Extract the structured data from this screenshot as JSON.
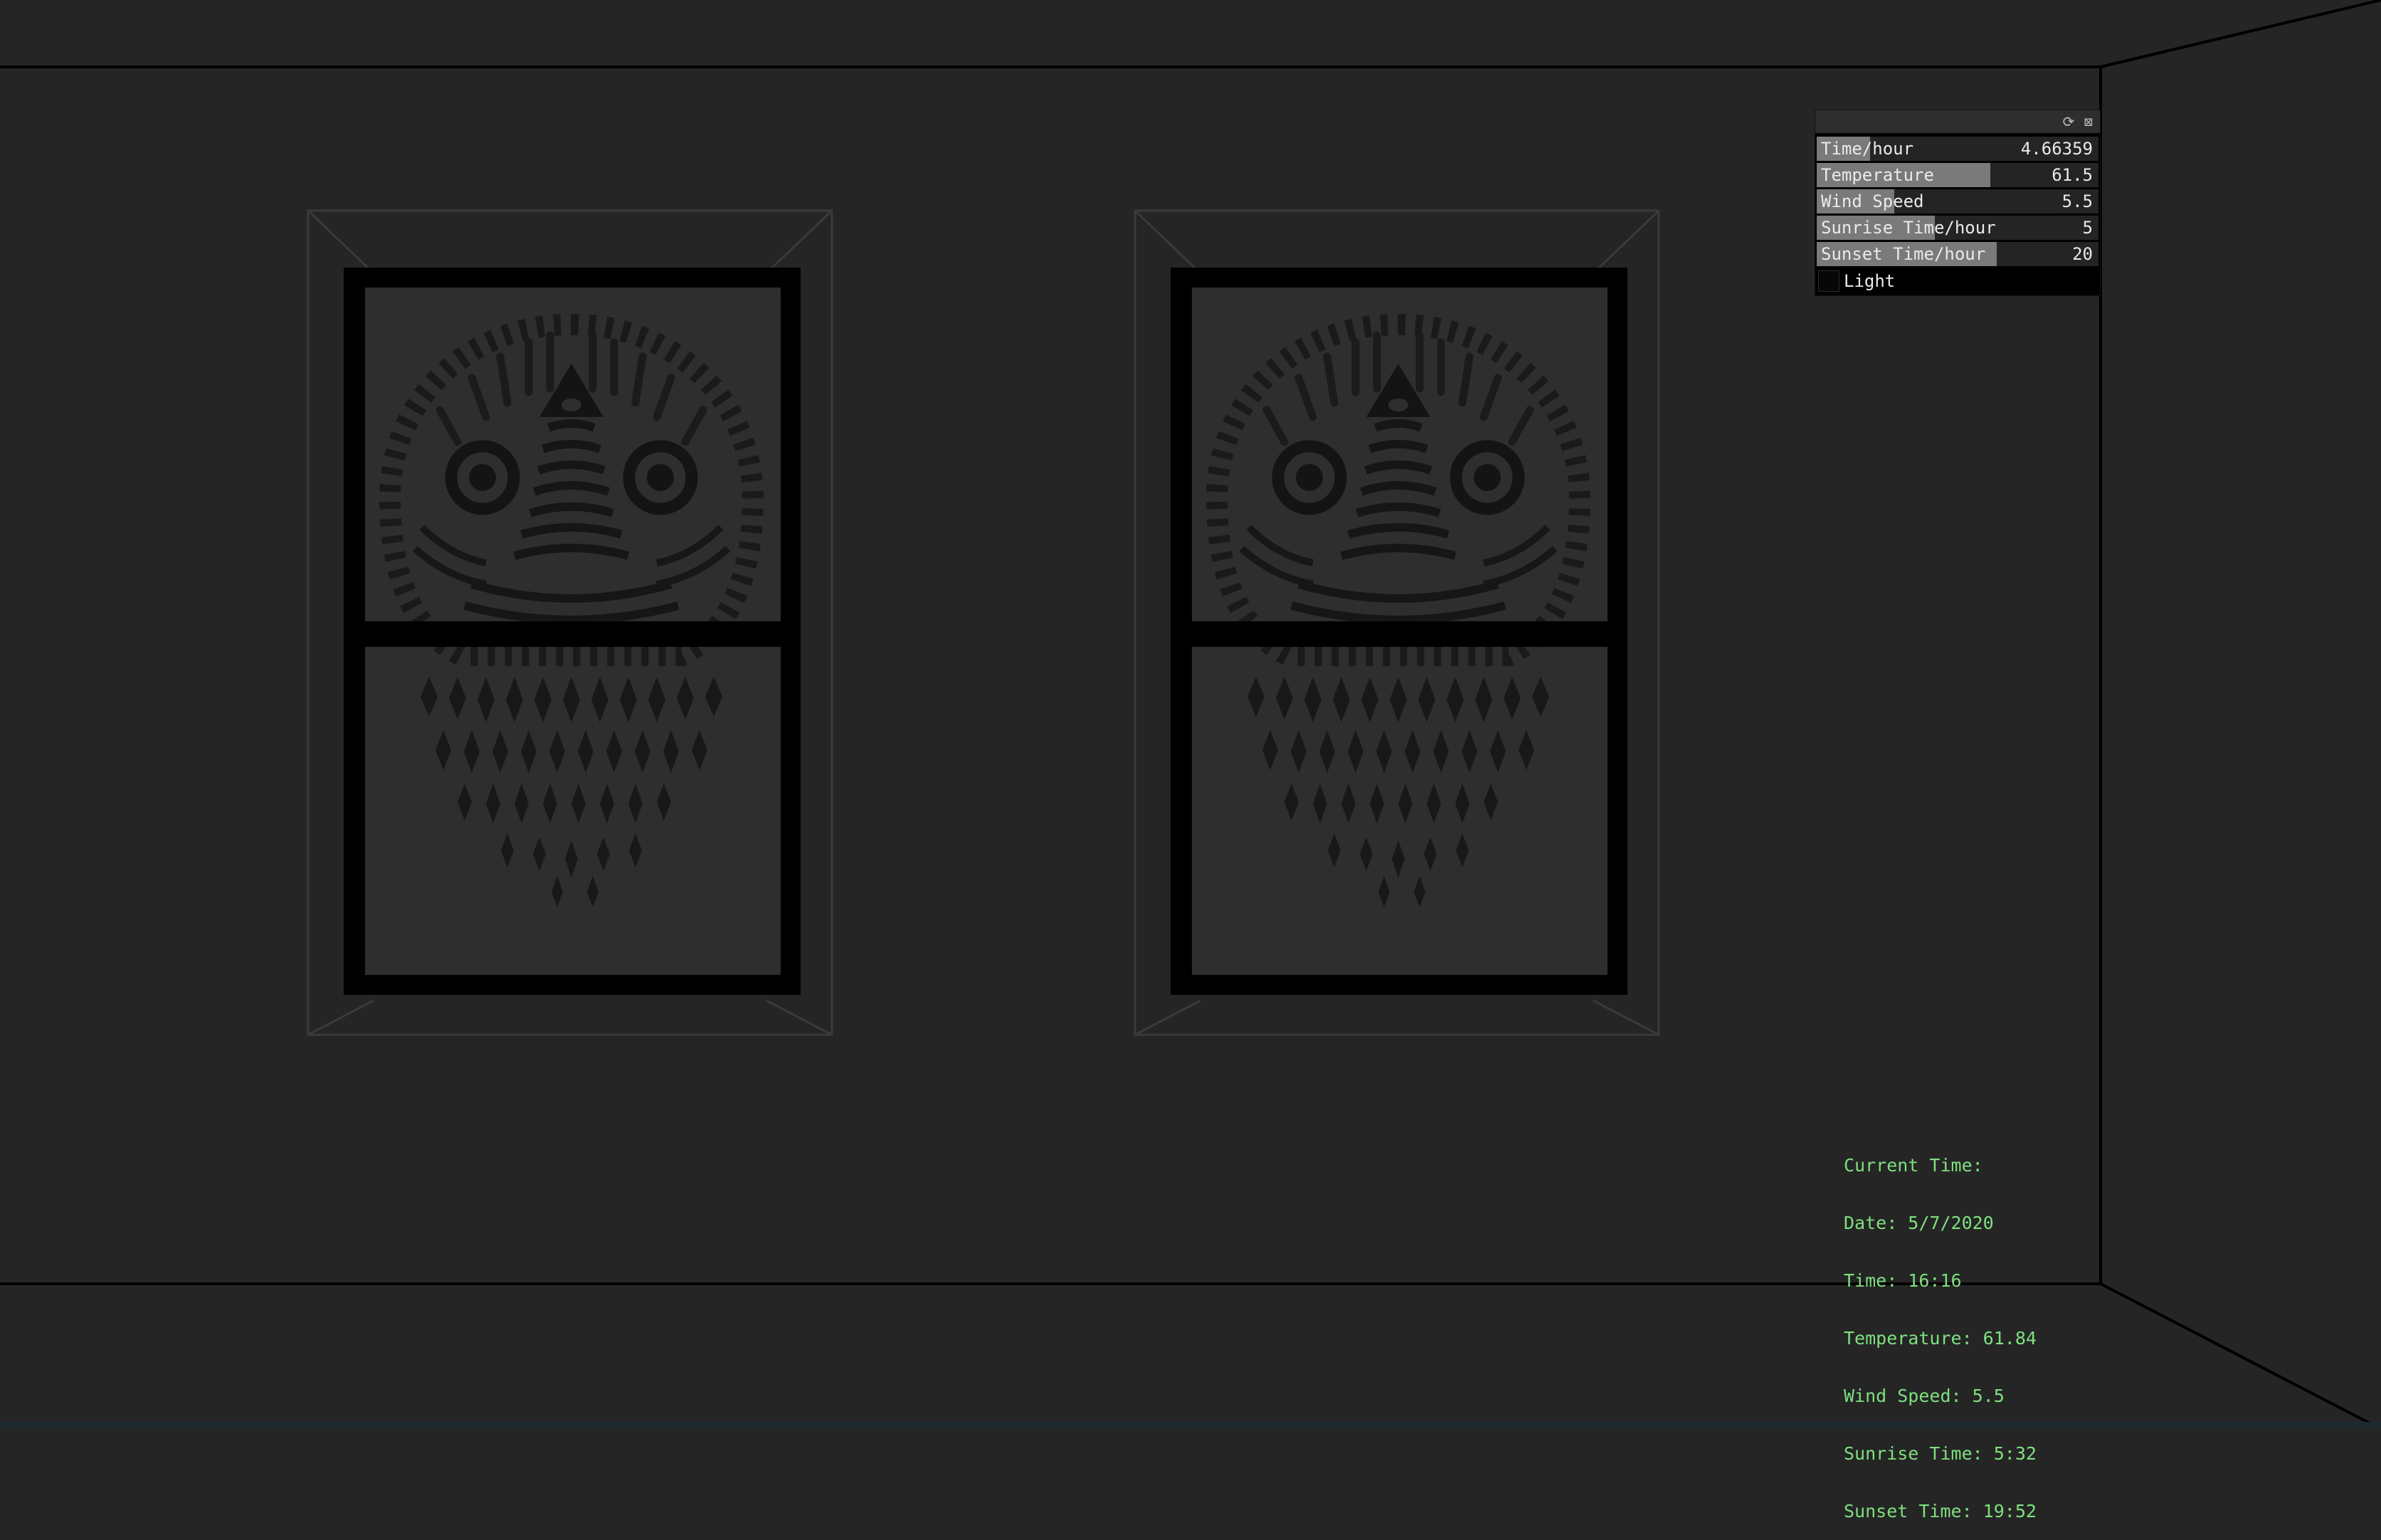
{
  "colors": {
    "background": "#252525",
    "info_text": "#7ee07e",
    "slider_fill": "#7a7a7a",
    "frame": "#000000",
    "glass": "#2e2e2e"
  },
  "gui": {
    "header_icons": [
      "refresh-icon",
      "save-icon"
    ],
    "sliders": [
      {
        "label": "Time/hour",
        "value": "4.66359",
        "fill_fraction": 0.19
      },
      {
        "label": "Temperature",
        "value": "61.5",
        "fill_fraction": 0.615
      },
      {
        "label": "Wind Speed",
        "value": "5.5",
        "fill_fraction": 0.275
      },
      {
        "label": "Sunrise Time/hour",
        "value": "5",
        "fill_fraction": 0.42
      },
      {
        "label": "Sunset Time/hour",
        "value": "20",
        "fill_fraction": 0.64
      }
    ],
    "toggle": {
      "label": "Light",
      "checked": false
    }
  },
  "info": {
    "heading": "Current Time:",
    "date": "Date: 5/7/2020",
    "time": "Time: 16:16",
    "temperature": "Temperature: 61.84",
    "wind_speed": "Wind Speed: 5.5",
    "sunrise": "Sunrise Time: 5:32",
    "sunset": "Sunset Time: 19:52"
  }
}
